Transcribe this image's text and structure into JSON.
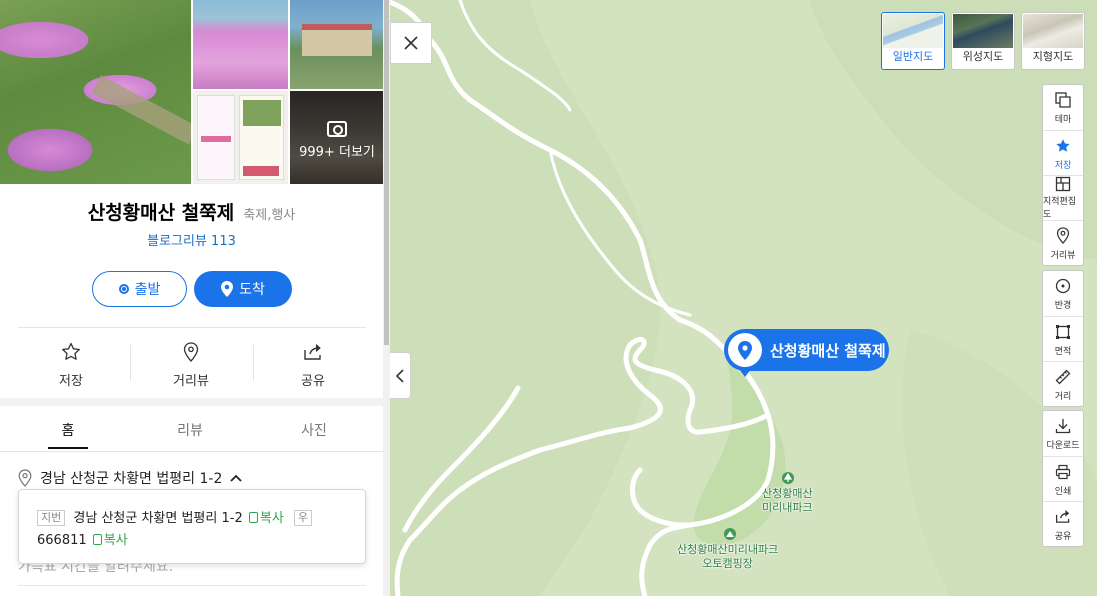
{
  "place": {
    "name": "산청황매산 철쭉제",
    "category": "축제,행사",
    "blog_review": "블로그리뷰 113"
  },
  "photos": {
    "more_label": "999+ 더보기"
  },
  "buttons": {
    "depart": "출발",
    "arrive": "도착"
  },
  "actions": {
    "save": "저장",
    "roadview": "거리뷰",
    "share": "공유"
  },
  "tabs": [
    "홈",
    "리뷰",
    "사진"
  ],
  "address": {
    "summary": "경남 산청군 차황면 법평리 1-2",
    "jibun_tag": "지번",
    "jibun": "경남 산청군 차황면 법평리 1-2",
    "copy": "복사",
    "zip_tag": "우",
    "zip": "666811",
    "hidden_row": "가득표 시간을 알려주세요."
  },
  "map": {
    "marker_label": "산청황매산 철쭉제",
    "labels": {
      "park": [
        "산청황매산",
        "미리내파크"
      ],
      "camping": [
        "산청황매산미리내파크",
        "오토캠핑장"
      ]
    },
    "map_types": [
      {
        "label": "일반지도",
        "active": true
      },
      {
        "label": "위성지도",
        "active": false
      },
      {
        "label": "지형지도",
        "active": false
      }
    ],
    "tools": {
      "theme": "테마",
      "save": "저장",
      "cadastral": "지적편집도",
      "roadview": "거리뷰",
      "radius": "반경",
      "area": "면적",
      "distance": "거리",
      "download": "다운로드",
      "print": "인쇄",
      "share": "공유"
    },
    "colors": {
      "accent": "#1a73e8",
      "map_green": "#d3e3c0",
      "park_green": "#c2dcaa",
      "copy_green": "#2fa64b"
    }
  }
}
